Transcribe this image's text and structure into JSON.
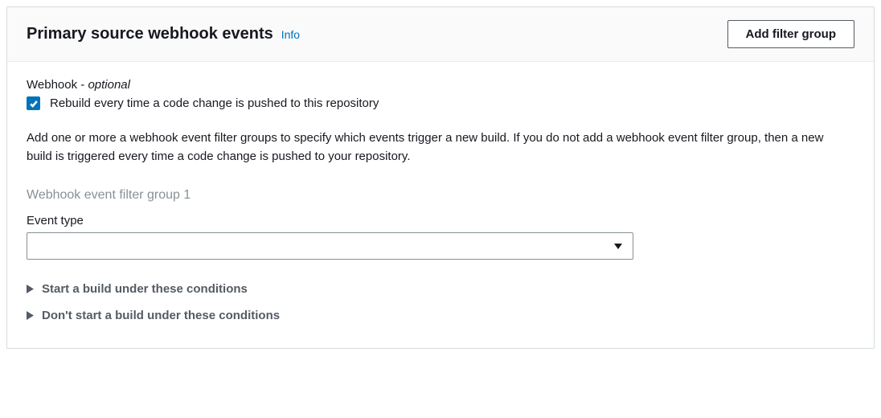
{
  "header": {
    "title": "Primary source webhook events",
    "info_link": "Info",
    "add_filter_button": "Add filter group"
  },
  "webhook": {
    "label_prefix": "Webhook - ",
    "label_optional": "optional",
    "checkbox_label": "Rebuild every time a code change is pushed to this repository",
    "checkbox_checked": true
  },
  "description": "Add one or more a webhook event filter groups to specify which events trigger a new build. If you do not add a webhook event filter group, then a new build is triggered every time a code change is pushed to your repository.",
  "filter_group": {
    "title": "Webhook event filter group 1",
    "event_type_label": "Event type",
    "event_type_value": ""
  },
  "expanders": {
    "start_conditions": "Start a build under these conditions",
    "dont_start_conditions": "Don't start a build under these conditions"
  }
}
